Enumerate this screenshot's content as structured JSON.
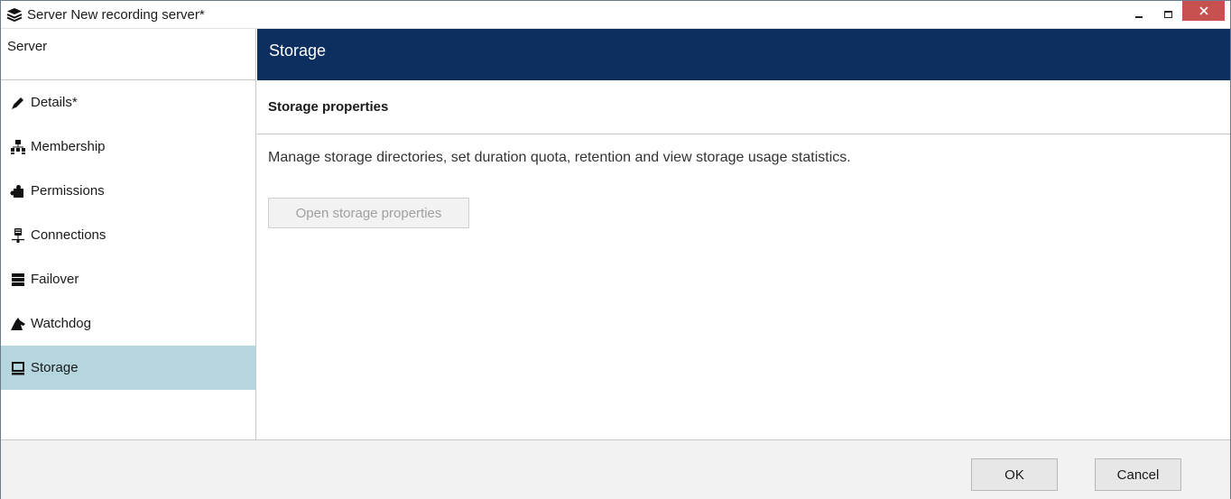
{
  "window": {
    "title": "Server New recording server*",
    "icon": "server-stack-icon",
    "close_color": "#c75050"
  },
  "sidebar": {
    "header": "Server",
    "items": [
      {
        "label": "Details*",
        "icon": "pencil-icon",
        "active": false
      },
      {
        "label": "Membership",
        "icon": "hierarchy-icon",
        "active": false
      },
      {
        "label": "Permissions",
        "icon": "puzzle-icon",
        "active": false
      },
      {
        "label": "Connections",
        "icon": "network-icon",
        "active": false
      },
      {
        "label": "Failover",
        "icon": "server-rack-icon",
        "active": false
      },
      {
        "label": "Watchdog",
        "icon": "dog-icon",
        "active": false
      },
      {
        "label": "Storage",
        "icon": "drive-icon",
        "active": true
      }
    ],
    "active_color": "#b5d6df"
  },
  "content": {
    "header": "Storage",
    "header_color": "#0d2f60",
    "section_title": "Storage properties",
    "description": "Manage storage directories, set duration quota, retention and view storage usage statistics.",
    "open_button_label": "Open storage properties"
  },
  "footer": {
    "ok_label": "OK",
    "cancel_label": "Cancel"
  }
}
